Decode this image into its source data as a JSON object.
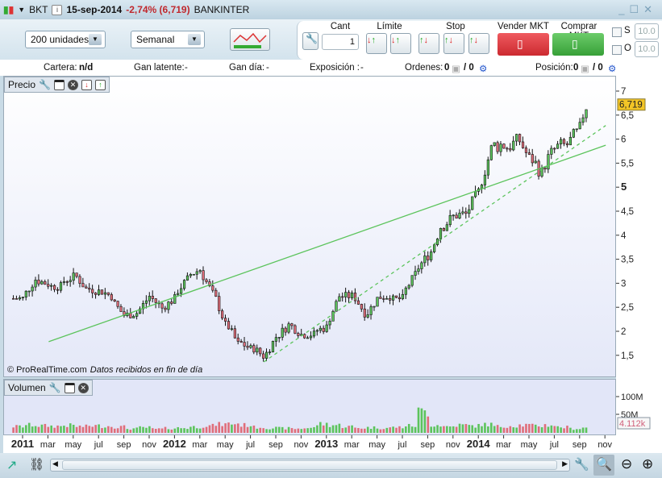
{
  "titlebar": {
    "ticker": "BKT",
    "date": "15-sep-2014",
    "change": "-2,74% (6,719)",
    "name": "BANKINTER",
    "icons": [
      "candlestick-icon",
      "info-icon",
      "minimize-icon",
      "maximize-icon",
      "close-icon"
    ]
  },
  "toolbar": {
    "units": "200 unidades",
    "period": "Semanal",
    "cant_label": "Cant",
    "cant_value": "1",
    "limit_label": "Límite",
    "stop_label": "Stop",
    "sell_label": "Vender MKT",
    "buy_label": "Comprar MKT",
    "s_label": "S",
    "o_label": "O",
    "s_value": "10.0",
    "o_value": "10.0",
    "sell_color": "#d9363c",
    "buy_color": "#45b046"
  },
  "info": {
    "cartera_label": "Cartera:",
    "cartera_value": "n/d",
    "gan_latente_label": "Gan latente:",
    "gan_latente_value": "-",
    "gan_dia_label": "Gan día:",
    "gan_dia_value": "-",
    "exposicion_label": "Exposición :",
    "exposicion_value": "-",
    "ordenes_label": "Ordenes:",
    "ordenes_a": "0",
    "ordenes_b": "/ 0",
    "posicion_label": "Posición:",
    "posicion_a": "0",
    "posicion_b": "/ 0"
  },
  "price_pane": {
    "title": "Precio",
    "copyright": "© ProRealTime.com",
    "data_note": "Datos recibidos en fin de día",
    "last_price": "6,719"
  },
  "volume_pane": {
    "title": "Volumen",
    "last_volume": "4.112k"
  },
  "chart_data": [
    {
      "type": "candlestick",
      "frequency": "weekly",
      "ylim": [
        1.3,
        7.3
      ],
      "y_ticks": [
        "1,5",
        "2",
        "2,5",
        "3",
        "3,5",
        "4",
        "4,5",
        "5",
        "5,5",
        "6",
        "6,5",
        "7"
      ],
      "y_tick_values": [
        1.5,
        2,
        2.5,
        3,
        3.5,
        4,
        4.5,
        5,
        5.5,
        6,
        6.5,
        7
      ],
      "last": 6.719,
      "up_color": "#5cc45c",
      "down_color": "#e06d7a",
      "monthly_closes_approx": [
        [
          "2010-12",
          2.7
        ],
        [
          "2011-01",
          3.1
        ],
        [
          "2011-02",
          3.0
        ],
        [
          "2011-03",
          2.95
        ],
        [
          "2011-04",
          3.15
        ],
        [
          "2011-05",
          2.9
        ],
        [
          "2011-06",
          2.85
        ],
        [
          "2011-07",
          2.75
        ],
        [
          "2011-08",
          2.35
        ],
        [
          "2011-09",
          2.4
        ],
        [
          "2011-10",
          2.75
        ],
        [
          "2011-11",
          2.5
        ],
        [
          "2011-12",
          2.7
        ],
        [
          "2012-01",
          3.1
        ],
        [
          "2012-02",
          3.3
        ],
        [
          "2012-03",
          2.8
        ],
        [
          "2012-04",
          2.15
        ],
        [
          "2012-05",
          1.75
        ],
        [
          "2012-06",
          1.65
        ],
        [
          "2012-07",
          1.5
        ],
        [
          "2012-08",
          1.9
        ],
        [
          "2012-09",
          2.15
        ],
        [
          "2012-10",
          1.95
        ],
        [
          "2012-11",
          1.95
        ],
        [
          "2012-12",
          2.1
        ],
        [
          "2013-01",
          2.75
        ],
        [
          "2013-02",
          2.75
        ],
        [
          "2013-03",
          2.4
        ],
        [
          "2013-04",
          2.7
        ],
        [
          "2013-05",
          2.75
        ],
        [
          "2013-06",
          2.7
        ],
        [
          "2013-07",
          3.2
        ],
        [
          "2013-08",
          3.6
        ],
        [
          "2013-09",
          4.2
        ],
        [
          "2013-10",
          4.4
        ],
        [
          "2013-11",
          4.45
        ],
        [
          "2013-12",
          4.9
        ],
        [
          "2014-01",
          5.8
        ],
        [
          "2014-02",
          5.9
        ],
        [
          "2014-03",
          5.95
        ],
        [
          "2014-04",
          5.6
        ],
        [
          "2014-05",
          5.3
        ],
        [
          "2014-06",
          5.8
        ],
        [
          "2014-07",
          5.9
        ],
        [
          "2014-08",
          6.2
        ],
        [
          "2014-09",
          6.72
        ]
      ],
      "trendlines": [
        {
          "style": "solid",
          "color": "#5cc45c",
          "from": [
            "2011-03",
            1.8
          ],
          "to": [
            "2014-11",
            5.89
          ]
        },
        {
          "style": "dashed",
          "color": "#5cc45c",
          "from": [
            "2012-08",
            1.38
          ],
          "to": [
            "2014-11",
            6.3
          ]
        }
      ]
    },
    {
      "type": "bar",
      "name": "Volumen",
      "y_ticks": [
        "50M",
        "100M"
      ],
      "y_tick_values": [
        50,
        100
      ],
      "unit": "M",
      "monthly_volume_approx": [
        18,
        22,
        20,
        19,
        21,
        18,
        20,
        19,
        17,
        12,
        15,
        11,
        13,
        14,
        17,
        20,
        24,
        26,
        22,
        16,
        14,
        13,
        12,
        14,
        25,
        22,
        18,
        14,
        15,
        14,
        16,
        20,
        60,
        22,
        18,
        22,
        20,
        24,
        18,
        20,
        22,
        20,
        22,
        16,
        12
      ]
    },
    {
      "type": "time_axis",
      "labels": [
        "2011",
        "mar",
        "may",
        "jul",
        "sep",
        "nov",
        "2012",
        "mar",
        "may",
        "jul",
        "sep",
        "nov",
        "2013",
        "mar",
        "may",
        "jul",
        "sep",
        "nov",
        "2014",
        "mar",
        "may",
        "jul",
        "sep",
        "nov"
      ]
    }
  ]
}
